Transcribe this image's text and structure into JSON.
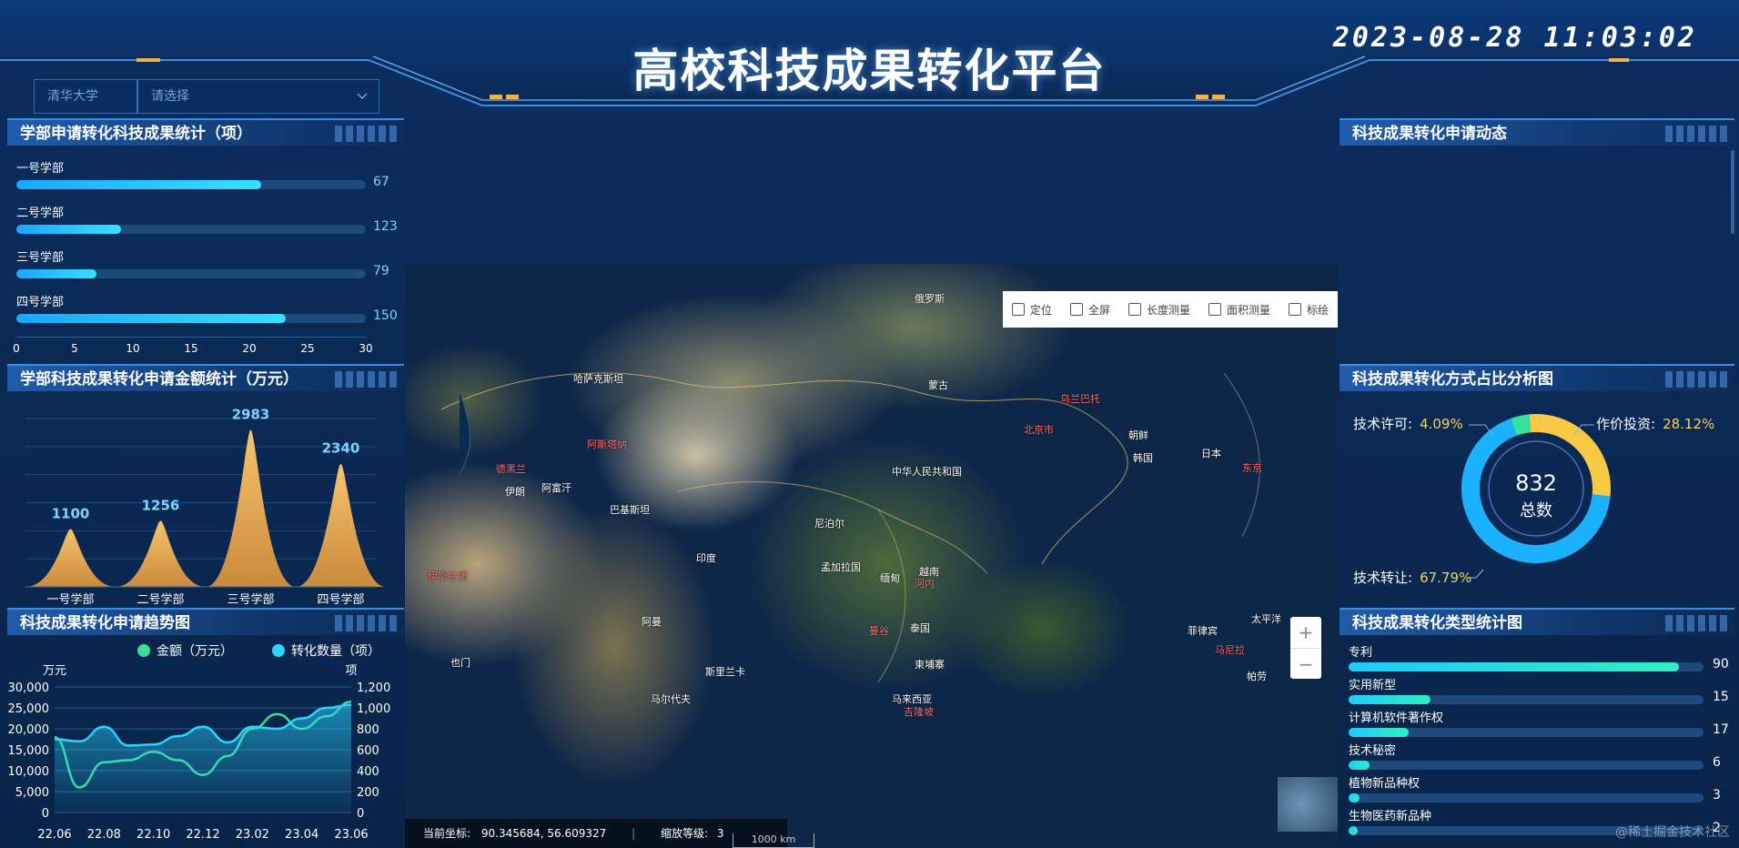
{
  "header": {
    "title": "高校科技成果转化平台",
    "datetime": "2023-08-28 11:03:02"
  },
  "filters": {
    "school": "清华大学",
    "select_placeholder": "请选择"
  },
  "panels": {
    "dept_count_title": "学部申请转化科技成果统计（项）",
    "dept_amount_title": "学部科技成果转化申请金额统计（万元）",
    "trend_title": "科技成果转化申请趋势图",
    "dynamic_title": "科技成果转化申请动态",
    "method_title": "科技成果转化方式占比分析图",
    "type_title": "科技成果转化类型统计图"
  },
  "dept_bars": {
    "items": [
      {
        "label": "一号学部",
        "value": 67,
        "fill": 0.7
      },
      {
        "label": "二号学部",
        "value": 123,
        "fill": 0.3
      },
      {
        "label": "三号学部",
        "value": 79,
        "fill": 0.23
      },
      {
        "label": "四号学部",
        "value": 150,
        "fill": 0.77
      }
    ],
    "axis_ticks": [
      "0",
      "5",
      "10",
      "15",
      "20",
      "25",
      "30"
    ]
  },
  "map": {
    "tools": [
      "定位",
      "全屏",
      "长度测量",
      "面积测量",
      "标绘"
    ],
    "tool_icons": [
      "locate-icon",
      "fullscreen-icon",
      "ruler-icon",
      "area-icon",
      "draw-icon"
    ],
    "zoom_in": "+",
    "zoom_out": "−",
    "coord_label": "当前坐标:",
    "coord_value": "90.345684, 56.609327",
    "zoom_label": "缩放等级:",
    "zoom_value": "3",
    "scale": "1000 km",
    "places": [
      {
        "name": "俄罗斯",
        "red": false
      },
      {
        "name": "哈萨克斯坦",
        "red": false
      },
      {
        "name": "蒙古",
        "red": false
      },
      {
        "name": "中华人民共和国",
        "red": false
      },
      {
        "name": "北京市",
        "red": true
      },
      {
        "name": "朝鲜",
        "red": false
      },
      {
        "name": "韩国",
        "red": false
      },
      {
        "name": "日本",
        "red": false
      },
      {
        "name": "东京",
        "red": true
      },
      {
        "name": "阿富汗",
        "red": false
      },
      {
        "name": "伊朗",
        "red": false
      },
      {
        "name": "巴基斯坦",
        "red": false
      },
      {
        "name": "尼泊尔",
        "red": false
      },
      {
        "name": "印度",
        "red": false
      },
      {
        "name": "孟加拉国",
        "red": false
      },
      {
        "name": "缅甸",
        "red": false
      },
      {
        "name": "泰国",
        "red": false
      },
      {
        "name": "越南",
        "red": false
      },
      {
        "name": "河内",
        "red": true
      },
      {
        "name": "菲律宾",
        "red": false
      },
      {
        "name": "马尼拉",
        "red": true
      },
      {
        "name": "柬埔寨",
        "red": false
      },
      {
        "name": "斯里兰卡",
        "red": false
      },
      {
        "name": "马尔代夫",
        "red": false
      },
      {
        "name": "马来西亚",
        "red": false
      },
      {
        "name": "吉隆坡",
        "red": true
      },
      {
        "name": "太平洋",
        "red": false
      },
      {
        "name": "阿斯塔纳",
        "red": true
      },
      {
        "name": "乌兰巴托",
        "red": true
      },
      {
        "name": "德黑兰",
        "red": true
      },
      {
        "name": "伊斯兰堡",
        "red": true
      },
      {
        "name": "曼谷",
        "red": true
      },
      {
        "name": "帕劳",
        "red": false
      },
      {
        "name": "也门",
        "red": false
      },
      {
        "name": "阿曼",
        "red": false
      }
    ]
  },
  "method_donut": {
    "total": "832",
    "total_label": "总数",
    "slices": [
      {
        "name": "技术许可:",
        "percent": 4.09,
        "display": "4.09%",
        "color": "#36e0a0"
      },
      {
        "name": "作价投资:",
        "percent": 28.12,
        "display": "28.12%",
        "color": "#f7c843"
      },
      {
        "name": "技术转让:",
        "percent": 67.79,
        "display": "67.79%",
        "color": "#1ab2ff"
      }
    ]
  },
  "type_bars": [
    {
      "label": "专利",
      "value": 90,
      "fill": 0.93
    },
    {
      "label": "实用新型",
      "value": 15,
      "fill": 0.23
    },
    {
      "label": "计算机软件著作权",
      "value": 17,
      "fill": 0.17
    },
    {
      "label": "技术秘密",
      "value": 6,
      "fill": 0.06
    },
    {
      "label": "植物新品种权",
      "value": 3,
      "fill": 0.03
    },
    {
      "label": "生物医药新品种",
      "value": 2,
      "fill": 0.02
    }
  ],
  "watermark": "@稀土掘金技术社区",
  "chart_data": [
    {
      "type": "area",
      "title": "学部科技成果转化申请金额统计（万元）",
      "categories": [
        "一号学部",
        "二号学部",
        "三号学部",
        "四号学部"
      ],
      "values": [
        1100,
        1256,
        2983,
        2340
      ],
      "ylim": [
        0,
        3200
      ],
      "grid": true,
      "color": "#f2b862"
    },
    {
      "type": "line",
      "title": "科技成果转化申请趋势图",
      "x": [
        "22.06",
        "22.07",
        "22.08",
        "22.09",
        "22.10",
        "22.11",
        "22.12",
        "23.01",
        "23.02",
        "23.03",
        "23.04",
        "23.05",
        "23.06"
      ],
      "xticks": [
        "22.06",
        "22.08",
        "22.10",
        "22.12",
        "23.02",
        "23.04",
        "23.06"
      ],
      "series": [
        {
          "name": "金额（万元）",
          "axis": "left",
          "color": "#3ddc97",
          "values": [
            18000,
            6000,
            12000,
            12500,
            14500,
            12500,
            9000,
            13500,
            20000,
            23500,
            20000,
            23000,
            26500
          ]
        },
        {
          "name": "转化数量（项）",
          "axis": "right",
          "color": "#2ad4ff",
          "values": [
            700,
            680,
            820,
            640,
            650,
            730,
            820,
            670,
            820,
            800,
            900,
            1000,
            1030
          ]
        }
      ],
      "ylabel_left": "万元",
      "ylabel_right": "项",
      "ylim_left": [
        0,
        30000
      ],
      "ylim_right": [
        0,
        1200
      ],
      "yticks_left": [
        "0",
        "5,000",
        "10,000",
        "15,000",
        "20,000",
        "25,000",
        "30,000"
      ],
      "yticks_right": [
        "0",
        "200",
        "400",
        "600",
        "800",
        "1,000",
        "1,200"
      ],
      "legend": "top-center",
      "grid": true
    }
  ]
}
